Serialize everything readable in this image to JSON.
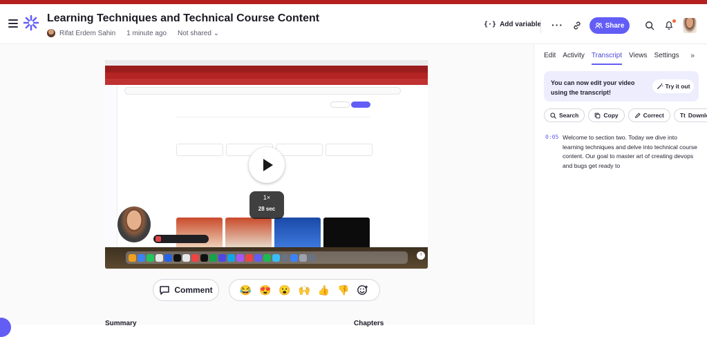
{
  "header": {
    "title": "Learning Techniques and Technical Course Content",
    "author": "Rifat Erdem Sahin",
    "time_ago": "1 minute ago",
    "sharing": "Not shared",
    "add_variable": "Add variable",
    "share": "Share"
  },
  "player": {
    "speed": "1×",
    "duration": "28 sec",
    "help": "?"
  },
  "actions": {
    "comment": "Comment",
    "reactions": [
      "😂",
      "😍",
      "😮",
      "🙌",
      "👍",
      "👎"
    ]
  },
  "sections": {
    "summary": "Summary",
    "chapters": "Chapters"
  },
  "panel": {
    "tabs": [
      "Edit",
      "Activity",
      "Transcript",
      "Views",
      "Settings"
    ],
    "active_tab": "Transcript",
    "banner_text": "You can now edit your video using the transcript!",
    "try_it": "Try it out",
    "buttons": [
      "Search",
      "Copy",
      "Correct",
      "Download"
    ],
    "transcript": [
      {
        "time": "0:05",
        "text": "Welcome to section two. Today we dive into learning techniques and delve into technical course content. Our goal to master art of creating devops and bugs get ready to"
      }
    ]
  },
  "colors": {
    "accent": "#625df5",
    "top_bar": "#b51f1f",
    "notification_dot": "#f26a2f"
  }
}
